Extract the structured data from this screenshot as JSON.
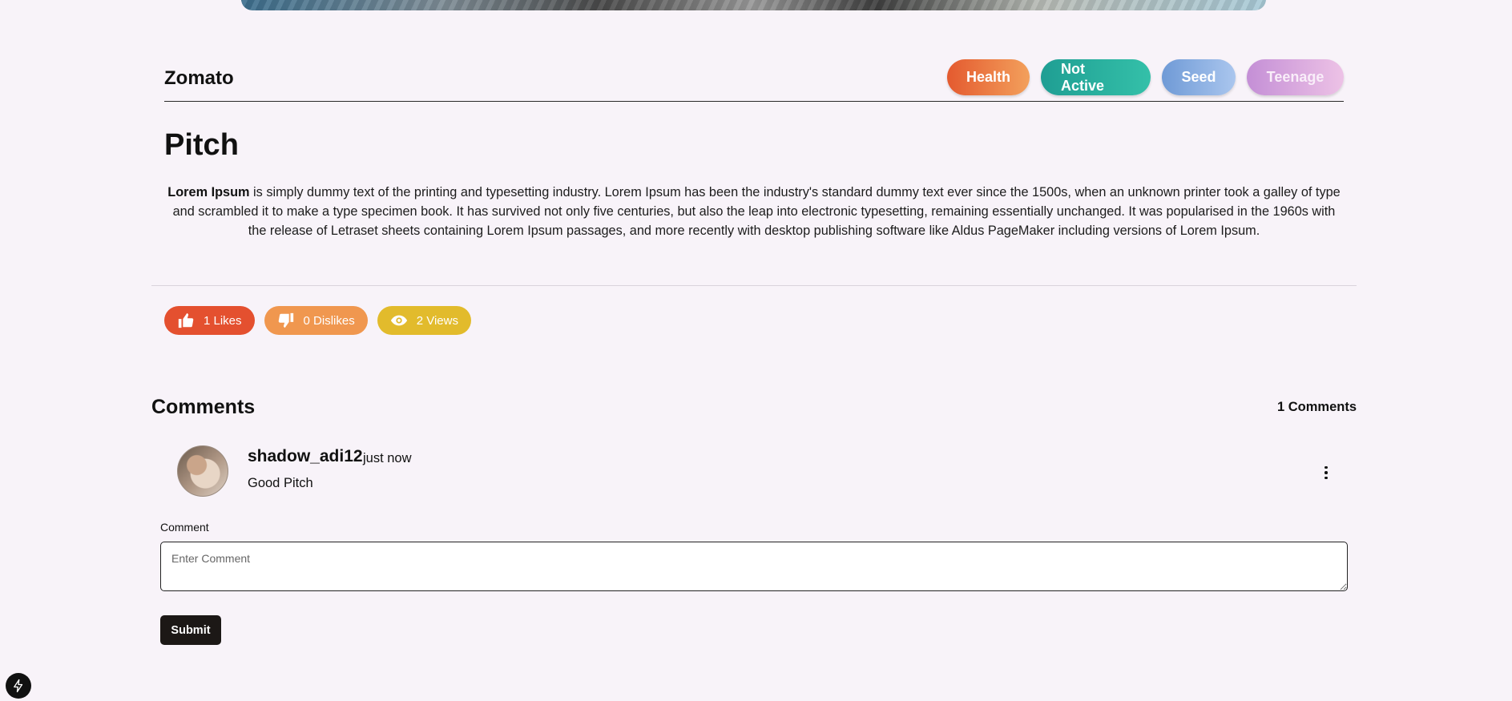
{
  "header": {
    "company": "Zomato",
    "tags": [
      "Health",
      "Not Active",
      "Seed",
      "Teenage"
    ]
  },
  "pitch": {
    "title": "Pitch",
    "description_bold": "Lorem Ipsum",
    "description_rest": " is simply dummy text of the printing and typesetting industry. Lorem Ipsum has been the industry's standard dummy text ever since the 1500s, when an unknown printer took a galley of type and scrambled it to make a type specimen book. It has survived not only five centuries, but also the leap into electronic typesetting, remaining essentially unchanged. It was popularised in the 1960s with the release of Letraset sheets containing Lorem Ipsum passages, and more recently with desktop publishing software like Aldus PageMaker including versions of Lorem Ipsum."
  },
  "stats": {
    "likes": "1 Likes",
    "dislikes": "0 Dislikes",
    "views": "2 Views"
  },
  "comments": {
    "title": "Comments",
    "count": "1 Comments",
    "items": [
      {
        "username": "shadow_adi12",
        "time": "just now",
        "text": "Good Pitch"
      }
    ]
  },
  "form": {
    "label": "Comment",
    "placeholder": "Enter Comment",
    "submit": "Submit"
  },
  "icons": {
    "like": "thumbs-up-icon",
    "dislike": "thumbs-down-icon",
    "views": "eye-icon",
    "more": "more-vertical-icon",
    "fab": "lightning-icon"
  },
  "colors": {
    "likes": "#e4502f",
    "dislikes": "#f0974f",
    "views": "#e2bb2c",
    "submit": "#1c1816"
  }
}
